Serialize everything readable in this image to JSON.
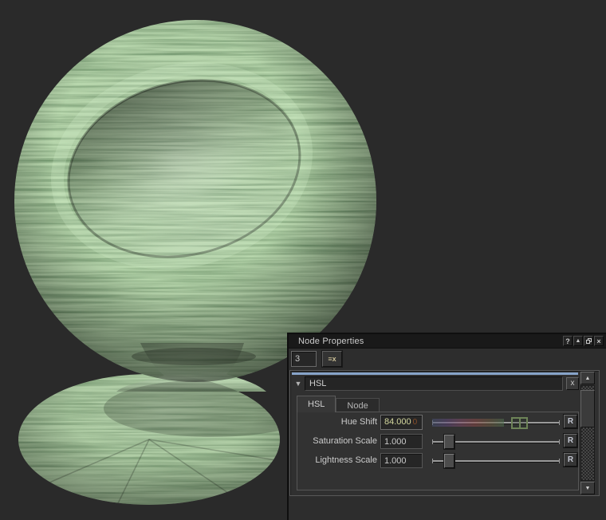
{
  "canvas": {
    "background_color": "#2a2a2a",
    "object": "wood-textured shader ball",
    "material_green_base": "#5d8a5d",
    "material_green_light": "#b9d8ae",
    "material_green_dark": "#4c7a4e"
  },
  "panel": {
    "title": "Node Properties",
    "titlebar_icons": {
      "help": "?",
      "collapse": "▲",
      "close": "×"
    },
    "toolbar": {
      "count_value": "3",
      "clear_glyph": "≡x"
    },
    "node_header": {
      "expander": "▼",
      "name": "HSL",
      "remove": "x",
      "accent_color": "#87a3c9"
    },
    "tabs": {
      "hsl": "HSL",
      "node": "Node"
    },
    "params": [
      {
        "label": "Hue Shift",
        "value": "84.000",
        "ghost": "0",
        "reset": "R"
      },
      {
        "label": "Saturation Scale",
        "value": "1.000",
        "reset": "R"
      },
      {
        "label": "Lightness Scale",
        "value": "1.000",
        "reset": "R"
      }
    ],
    "scrollbar": {
      "up": "▲",
      "down": "▼"
    }
  }
}
